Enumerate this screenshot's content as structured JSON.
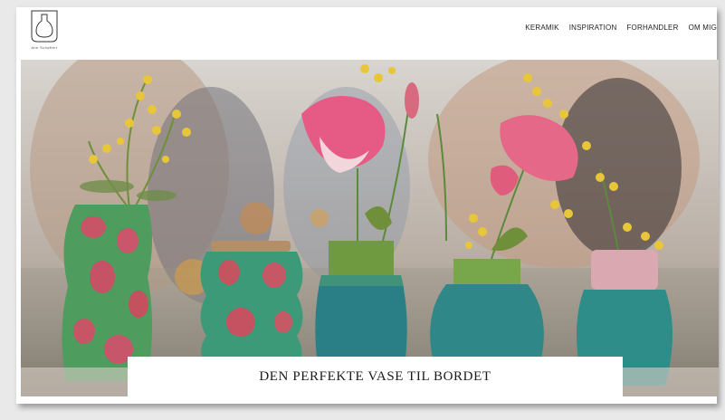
{
  "brand": {
    "name": "Ane Schaffert",
    "logo_icon": "vase-logo-icon"
  },
  "nav": {
    "items": [
      {
        "label": "KERAMIK"
      },
      {
        "label": "INSPIRATION"
      },
      {
        "label": "FORHANDLER"
      },
      {
        "label": "OM MIG"
      }
    ]
  },
  "hero": {
    "caption": "DEN PERFEKTE VASE TIL BORDET"
  },
  "colors": {
    "accent_green": "#3f9a6a",
    "accent_teal": "#2e7f86",
    "accent_pink": "#d9577a"
  }
}
